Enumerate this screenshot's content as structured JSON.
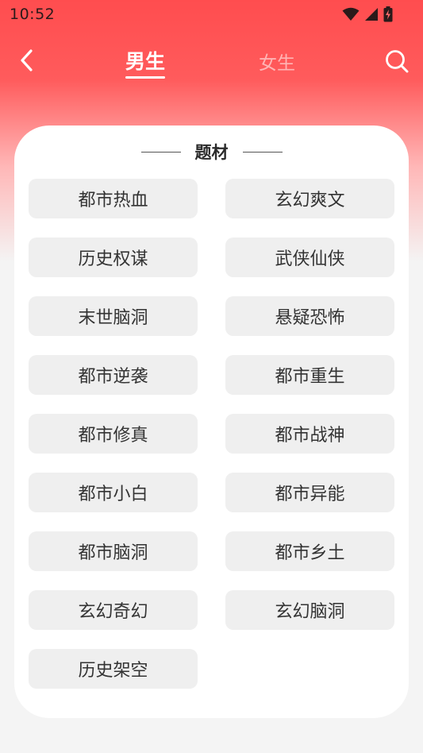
{
  "status_bar": {
    "time": "10:52",
    "icons": [
      "wifi-icon",
      "cell-signal-icon",
      "battery-charging-icon"
    ]
  },
  "nav": {
    "back_icon": "chevron-left-icon",
    "tabs": [
      {
        "label": "男生",
        "active": true
      },
      {
        "label": "女生",
        "active": false
      }
    ],
    "search_icon": "search-icon"
  },
  "colors": {
    "accent": "#ff4d4f",
    "card_bg": "#ffffff",
    "chip_bg": "#efefef",
    "page_bg": "#f4f4f4"
  },
  "section": {
    "title": "题材",
    "genres": [
      "都市热血",
      "玄幻爽文",
      "历史权谋",
      "武侠仙侠",
      "末世脑洞",
      "悬疑恐怖",
      "都市逆袭",
      "都市重生",
      "都市修真",
      "都市战神",
      "都市小白",
      "都市异能",
      "都市脑洞",
      "都市乡土",
      "玄幻奇幻",
      "玄幻脑洞",
      "历史架空"
    ]
  }
}
